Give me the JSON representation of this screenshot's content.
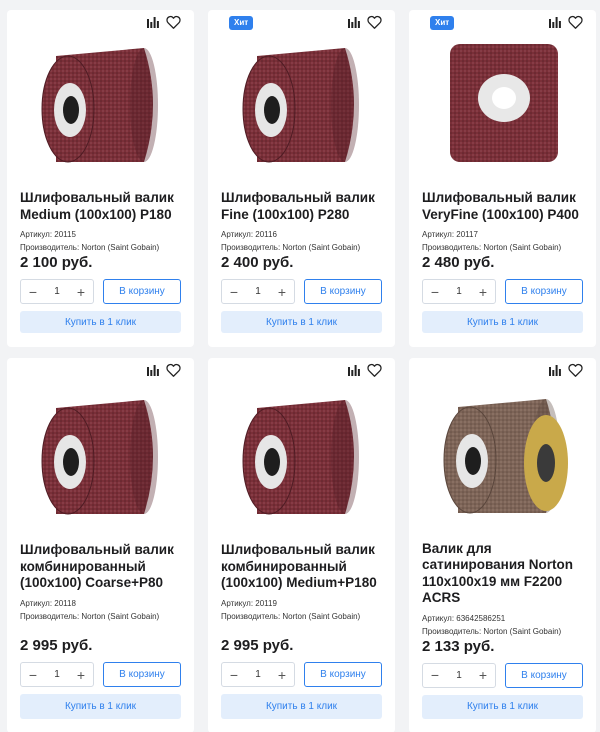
{
  "colors": {
    "accent": "#2f80ed",
    "roller_red": "#7a2f38",
    "roller_brown": "#7d6457",
    "badge_bg": "#2f80ed"
  },
  "labels": {
    "article_prefix": "Артикул:",
    "maker_prefix": "Производитель:",
    "cart": "В корзину",
    "oneclick": "Купить в 1 клик",
    "minus": "−",
    "plus": "+"
  },
  "products": [
    {
      "title": "Шлифовальный валик Medium (100x100) P180",
      "article": "Артикул: 20115",
      "maker": "Производитель: Norton (Saint Gobain)",
      "price": "2 100 руб.",
      "qty": "1",
      "badge": "",
      "image": "red-roller"
    },
    {
      "title": "Шлифовальный валик Fine (100x100) P280",
      "article": "Артикул: 20116",
      "maker": "Производитель: Norton (Saint Gobain)",
      "price": "2 400 руб.",
      "qty": "1",
      "badge": "Хит",
      "image": "red-roller"
    },
    {
      "title": "Шлифовальный валик VeryFine (100x100) P400",
      "article": "Артикул: 20117",
      "maker": "Производитель: Norton (Saint Gobain)",
      "price": "2 480 руб.",
      "qty": "1",
      "badge": "Хит",
      "image": "red-roller-front"
    },
    {
      "title": "Шлифовальный валик комбинированный (100x100) Coarse+P80",
      "article": "Артикул: 20118",
      "maker": "Производитель: Norton (Saint Gobain)",
      "price": "2 995 руб.",
      "qty": "1",
      "badge": "",
      "image": "red-roller-combo"
    },
    {
      "title": "Шлифовальный валик комбинированный (100x100) Medium+P180",
      "article": "Артикул: 20119",
      "maker": "Производитель: Norton (Saint Gobain)",
      "price": "2 995 руб.",
      "qty": "1",
      "badge": "",
      "image": "red-roller-combo"
    },
    {
      "title": "Валик для сатинирования Norton 110x100x19 мм F2200 ACRS",
      "article": "Артикул: 63642586251",
      "maker": "Производитель: Norton (Saint Gobain)",
      "price": "2 133 руб.",
      "qty": "1",
      "badge": "",
      "image": "brown-roller"
    }
  ]
}
